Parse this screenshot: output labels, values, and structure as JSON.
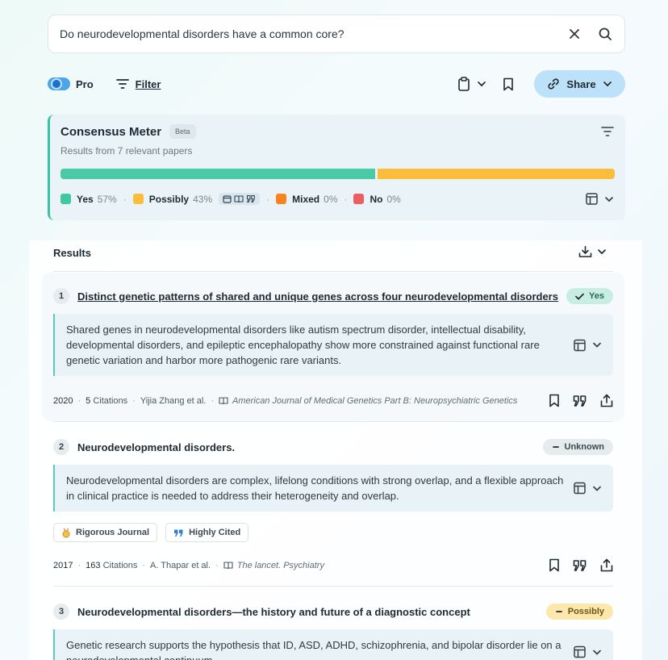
{
  "search": {
    "query": "Do neurodevelopmental disorders have a common core?",
    "clear_icon": "close-icon",
    "search_icon": "search-icon"
  },
  "toolbar": {
    "pro_label": "Pro",
    "pro_enabled": true,
    "filter_label": "Filter",
    "share_label": "Share"
  },
  "meter": {
    "title": "Consensus Meter",
    "beta_label": "Beta",
    "subtitle": "Results from 7 relevant papers",
    "bar": {
      "yes": 57,
      "possibly": 43
    },
    "legend": [
      {
        "label": "Yes",
        "pct": "57%",
        "color": "#3fc9a3"
      },
      {
        "label": "Possibly",
        "pct": "43%",
        "color": "#fbbd3a"
      },
      {
        "label": "Mixed",
        "pct": "0%",
        "color": "#f7841e"
      },
      {
        "label": "No",
        "pct": "0%",
        "color": "#ec5e61"
      }
    ]
  },
  "results": {
    "heading": "Results",
    "items": [
      {
        "num": "1",
        "title": "Distinct genetic patterns of shared and unique genes across four neurodevelopmental disorders",
        "badge": "Yes",
        "abstract": "Shared genes in neurodevelopmental disorders like autism spectrum disorder, intellectual disability, developmental disorders, and epileptic encephalopathy show more constrained against functional rare genetic variation and harbor more pathogenic rare variants.",
        "year": "2020",
        "citations_count": "5",
        "citations_label": "Citations",
        "authors": "Yijia Zhang et al.",
        "journal": "American Journal of Medical Genetics Part B: Neuropsychiatric Genetics"
      },
      {
        "num": "2",
        "title": "Neurodevelopmental disorders.",
        "badge": "Unknown",
        "abstract": "Neurodevelopmental disorders are complex, lifelong conditions with strong overlap, and a flexible approach in clinical practice is needed to address their heterogeneity and overlap.",
        "tags": [
          "Rigorous Journal",
          "Highly Cited"
        ],
        "year": "2017",
        "citations_count": "163",
        "citations_label": "Citations",
        "authors": "A. Thapar et al.",
        "journal": "The lancet. Psychiatry"
      },
      {
        "num": "3",
        "title": "Neurodevelopmental disorders—the history and future of a diagnostic concept",
        "badge": "Possibly",
        "abstract": "Genetic research supports the hypothesis that ID, ASD, ADHD, schizophrenia, and bipolar disorder lie on a neurodevelopmental continuum."
      }
    ]
  }
}
